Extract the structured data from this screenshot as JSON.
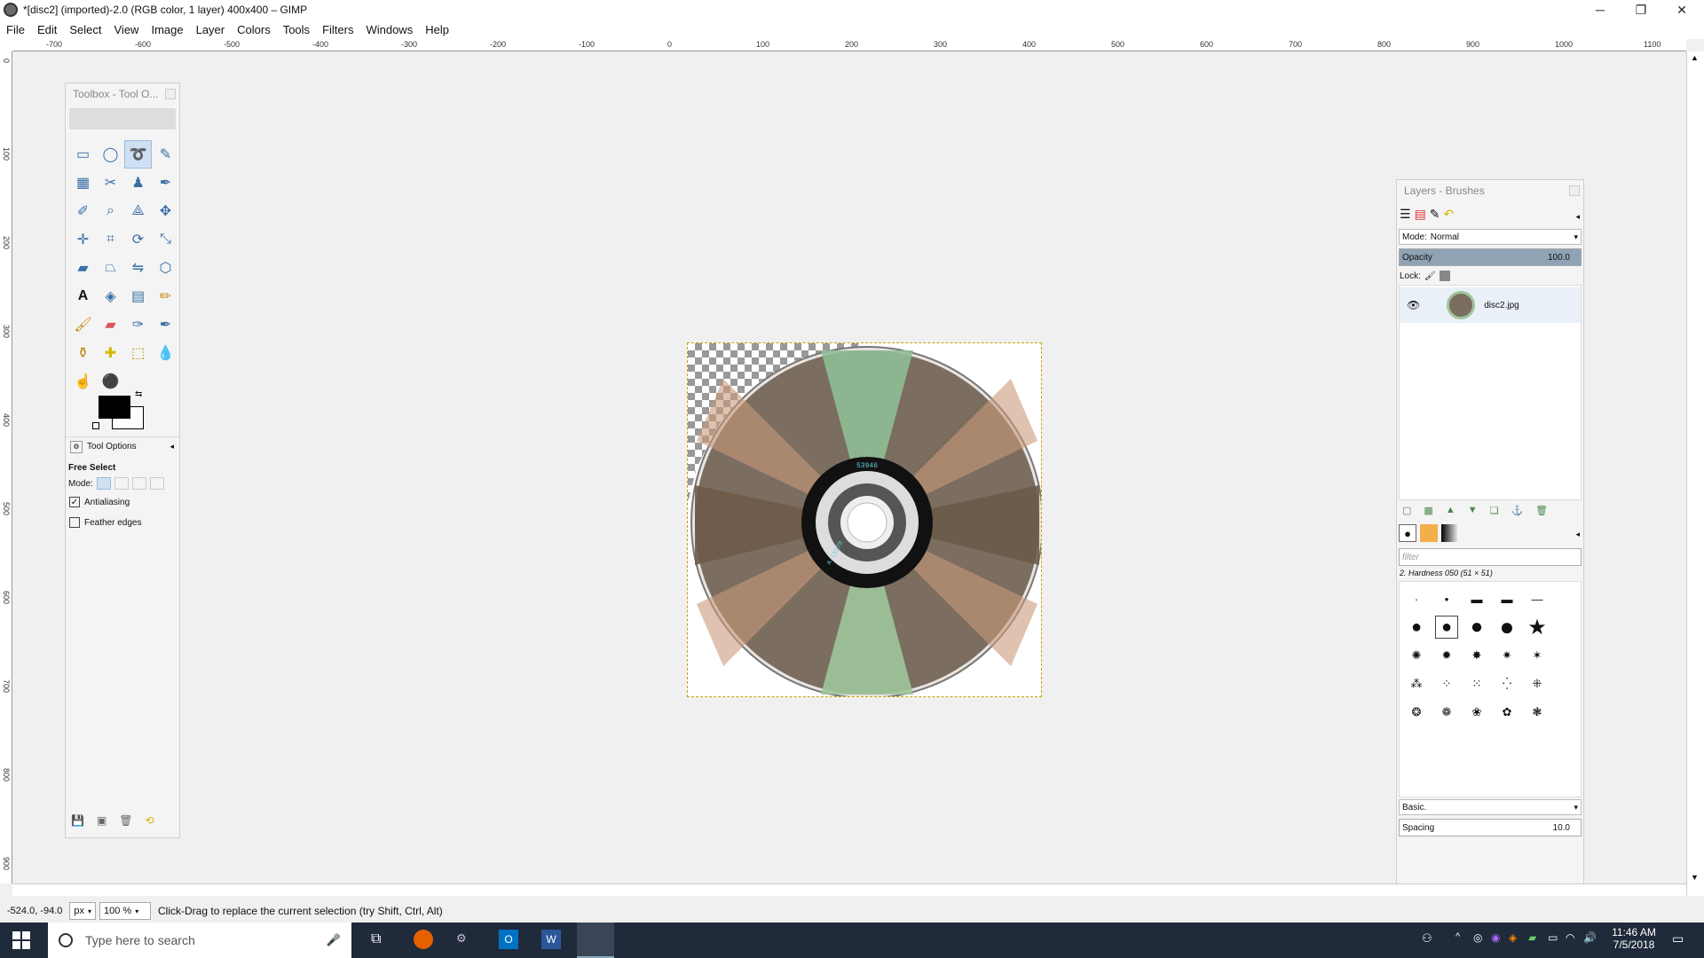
{
  "window": {
    "title": "*[disc2] (imported)-2.0 (RGB color, 1 layer) 400x400 – GIMP",
    "minimize": "─",
    "maximize": "❐",
    "close": "✕"
  },
  "menubar": [
    "File",
    "Edit",
    "Select",
    "View",
    "Image",
    "Layer",
    "Colors",
    "Tools",
    "Filters",
    "Windows",
    "Help"
  ],
  "ruler": {
    "h_labels": [
      "-700",
      "-600",
      "-500",
      "-400",
      "-300",
      "-200",
      "-100",
      "0",
      "100",
      "200",
      "300",
      "400",
      "500",
      "600",
      "700",
      "800",
      "900",
      "1000",
      "1100"
    ],
    "v_labels": [
      "0",
      "100",
      "200",
      "300",
      "400",
      "500",
      "600",
      "700",
      "800",
      "900"
    ]
  },
  "toolbox": {
    "title": "Toolbox - Tool O...",
    "tool_options_tab": "Tool Options",
    "tool_name": "Free Select",
    "mode_label": "Mode:",
    "antialiasing_label": "Antialiasing",
    "antialiasing_checked": true,
    "feather_label": "Feather edges",
    "feather_checked": false,
    "fg_color": "#000000",
    "bg_color": "#ffffff"
  },
  "image": {
    "disc_label_top": "53946",
    "disc_label_side": "A-11170"
  },
  "statusbar": {
    "coords": "-524.0, -94.0",
    "unit": "px",
    "zoom": "100 %",
    "message": "Click-Drag to replace the current selection (try Shift, Ctrl, Alt)"
  },
  "layers": {
    "title": "Layers - Brushes",
    "mode_label": "Mode:",
    "mode_value": "Normal",
    "opacity_label": "Opacity",
    "opacity_value": "100.0",
    "lock_label": "Lock:",
    "layer_name": "disc2.jpg",
    "filter_placeholder": "filter",
    "brush_name": "2. Hardness 050 (51 × 51)",
    "brush_preset": "Basic.",
    "spacing_label": "Spacing",
    "spacing_value": "10.0"
  },
  "taskbar": {
    "search_placeholder": "Type here to search",
    "time": "11:46 AM",
    "date": "7/5/2018"
  },
  "colors": {
    "selection": "#c8a000",
    "taskbar": "#1f2a3a",
    "accent": "#3a6ea5"
  }
}
